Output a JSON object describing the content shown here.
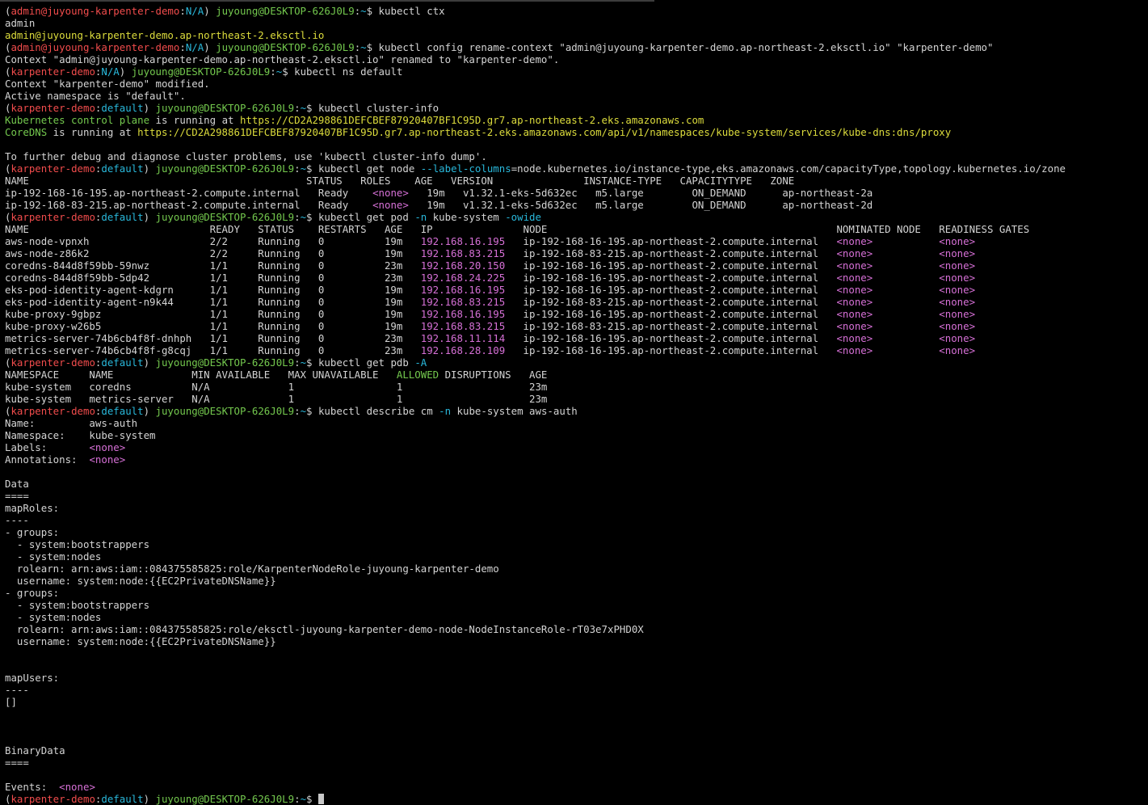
{
  "colors": {
    "background": "#000000",
    "default": "#d4d4d4",
    "red": "#f14c4c",
    "green": "#74c94e",
    "yellow": "#dcdc3c",
    "cyan": "#29b8db",
    "magenta": "#d670d6"
  },
  "lines": [
    [
      [
        "default",
        "("
      ],
      [
        "red",
        "admin@juyoung-karpenter-demo"
      ],
      [
        "default",
        ":"
      ],
      [
        "cyan",
        "N/A"
      ],
      [
        "default",
        ") "
      ],
      [
        "green",
        "juyoung@DESKTOP-626J0L9"
      ],
      [
        "default",
        ":"
      ],
      [
        "cyan",
        "~"
      ],
      [
        "default",
        "$ kubectl ctx"
      ]
    ],
    [
      [
        "default",
        "admin"
      ]
    ],
    [
      [
        "yellow",
        "admin@juyoung-karpenter-demo.ap-northeast-2.eksctl.io"
      ]
    ],
    [
      [
        "default",
        "("
      ],
      [
        "red",
        "admin@juyoung-karpenter-demo"
      ],
      [
        "default",
        ":"
      ],
      [
        "cyan",
        "N/A"
      ],
      [
        "default",
        ") "
      ],
      [
        "green",
        "juyoung@DESKTOP-626J0L9"
      ],
      [
        "default",
        ":"
      ],
      [
        "cyan",
        "~"
      ],
      [
        "default",
        "$ kubectl config rename-context \"admin@juyoung-karpenter-demo.ap-northeast-2.eksctl.io\" \"karpenter-demo\""
      ]
    ],
    [
      [
        "default",
        "Context \"admin@juyoung-karpenter-demo.ap-northeast-2.eksctl.io\" renamed to \"karpenter-demo\"."
      ]
    ],
    [
      [
        "default",
        "("
      ],
      [
        "red",
        "karpenter-demo"
      ],
      [
        "default",
        ":"
      ],
      [
        "cyan",
        "N/A"
      ],
      [
        "default",
        ") "
      ],
      [
        "green",
        "juyoung@DESKTOP-626J0L9"
      ],
      [
        "default",
        ":"
      ],
      [
        "cyan",
        "~"
      ],
      [
        "default",
        "$ kubectl ns default"
      ]
    ],
    [
      [
        "default",
        "Context \"karpenter-demo\" modified."
      ]
    ],
    [
      [
        "default",
        "Active namespace is \"default\"."
      ]
    ],
    [
      [
        "default",
        "("
      ],
      [
        "red",
        "karpenter-demo"
      ],
      [
        "default",
        ":"
      ],
      [
        "cyan",
        "default"
      ],
      [
        "default",
        ") "
      ],
      [
        "green",
        "juyoung@DESKTOP-626J0L9"
      ],
      [
        "default",
        ":"
      ],
      [
        "cyan",
        "~"
      ],
      [
        "default",
        "$ kubectl cluster-info"
      ]
    ],
    [
      [
        "green",
        "Kubernetes control plane"
      ],
      [
        "default",
        " is running at "
      ],
      [
        "yellow",
        "https://CD2A298861DEFCBEF87920407BF1C95D.gr7.ap-northeast-2.eks.amazonaws.com"
      ]
    ],
    [
      [
        "green",
        "CoreDNS"
      ],
      [
        "default",
        " is running at "
      ],
      [
        "yellow",
        "https://CD2A298861DEFCBEF87920407BF1C95D.gr7.ap-northeast-2.eks.amazonaws.com/api/v1/namespaces/kube-system/services/kube-dns:dns/proxy"
      ]
    ],
    [
      [
        "default",
        ""
      ]
    ],
    [
      [
        "default",
        "To further debug and diagnose cluster problems, use 'kubectl cluster-info dump'."
      ]
    ],
    [
      [
        "default",
        "("
      ],
      [
        "red",
        "karpenter-demo"
      ],
      [
        "default",
        ":"
      ],
      [
        "cyan",
        "default"
      ],
      [
        "default",
        ") "
      ],
      [
        "green",
        "juyoung@DESKTOP-626J0L9"
      ],
      [
        "default",
        ":"
      ],
      [
        "cyan",
        "~"
      ],
      [
        "default",
        "$ kubectl get node "
      ],
      [
        "cyan",
        "--label-columns"
      ],
      [
        "default",
        "=node.kubernetes.io/instance-type,eks.amazonaws.com/capacityType,topology.kubernetes.io/zone"
      ]
    ],
    [
      [
        "default",
        "NAME                                              STATUS   ROLES    AGE   VERSION               INSTANCE-TYPE   CAPACITYTYPE   ZONE"
      ]
    ],
    [
      [
        "default",
        "ip-192-168-16-195.ap-northeast-2.compute.internal   Ready    "
      ],
      [
        "magenta",
        "<none>"
      ],
      [
        "default",
        "   19m   v1.32.1-eks-5d632ec   m5.large        ON_DEMAND      ap-northeast-2a"
      ]
    ],
    [
      [
        "default",
        "ip-192-168-83-215.ap-northeast-2.compute.internal   Ready    "
      ],
      [
        "magenta",
        "<none>"
      ],
      [
        "default",
        "   19m   v1.32.1-eks-5d632ec   m5.large        ON_DEMAND      ap-northeast-2d"
      ]
    ],
    [
      [
        "default",
        "("
      ],
      [
        "red",
        "karpenter-demo"
      ],
      [
        "default",
        ":"
      ],
      [
        "cyan",
        "default"
      ],
      [
        "default",
        ") "
      ],
      [
        "green",
        "juyoung@DESKTOP-626J0L9"
      ],
      [
        "default",
        ":"
      ],
      [
        "cyan",
        "~"
      ],
      [
        "default",
        "$ kubectl get pod "
      ],
      [
        "cyan",
        "-n"
      ],
      [
        "default",
        " kube-system "
      ],
      [
        "cyan",
        "-owide"
      ]
    ],
    [
      [
        "default",
        "NAME                              READY   STATUS    RESTARTS   AGE   IP               NODE                                                NOMINATED NODE   READINESS GATES"
      ]
    ],
    [
      [
        "default",
        "aws-node-vpnxh                    2/2     Running   0          19m   "
      ],
      [
        "magenta",
        "192.168.16.195"
      ],
      [
        "default",
        "   ip-192-168-16-195.ap-northeast-2.compute.internal   "
      ],
      [
        "magenta",
        "<none>"
      ],
      [
        "default",
        "           "
      ],
      [
        "magenta",
        "<none>"
      ]
    ],
    [
      [
        "default",
        "aws-node-z86k2                    2/2     Running   0          19m   "
      ],
      [
        "magenta",
        "192.168.83.215"
      ],
      [
        "default",
        "   ip-192-168-83-215.ap-northeast-2.compute.internal   "
      ],
      [
        "magenta",
        "<none>"
      ],
      [
        "default",
        "           "
      ],
      [
        "magenta",
        "<none>"
      ]
    ],
    [
      [
        "default",
        "coredns-844d8f59bb-59nwz          1/1     Running   0          23m   "
      ],
      [
        "magenta",
        "192.168.20.150"
      ],
      [
        "default",
        "   ip-192-168-16-195.ap-northeast-2.compute.internal   "
      ],
      [
        "magenta",
        "<none>"
      ],
      [
        "default",
        "           "
      ],
      [
        "magenta",
        "<none>"
      ]
    ],
    [
      [
        "default",
        "coredns-844d8f59bb-5dp42          1/1     Running   0          23m   "
      ],
      [
        "magenta",
        "192.168.24.225"
      ],
      [
        "default",
        "   ip-192-168-16-195.ap-northeast-2.compute.internal   "
      ],
      [
        "magenta",
        "<none>"
      ],
      [
        "default",
        "           "
      ],
      [
        "magenta",
        "<none>"
      ]
    ],
    [
      [
        "default",
        "eks-pod-identity-agent-kdgrn      1/1     Running   0          19m   "
      ],
      [
        "magenta",
        "192.168.16.195"
      ],
      [
        "default",
        "   ip-192-168-16-195.ap-northeast-2.compute.internal   "
      ],
      [
        "magenta",
        "<none>"
      ],
      [
        "default",
        "           "
      ],
      [
        "magenta",
        "<none>"
      ]
    ],
    [
      [
        "default",
        "eks-pod-identity-agent-n9k44      1/1     Running   0          19m   "
      ],
      [
        "magenta",
        "192.168.83.215"
      ],
      [
        "default",
        "   ip-192-168-83-215.ap-northeast-2.compute.internal   "
      ],
      [
        "magenta",
        "<none>"
      ],
      [
        "default",
        "           "
      ],
      [
        "magenta",
        "<none>"
      ]
    ],
    [
      [
        "default",
        "kube-proxy-9gbpz                  1/1     Running   0          19m   "
      ],
      [
        "magenta",
        "192.168.16.195"
      ],
      [
        "default",
        "   ip-192-168-16-195.ap-northeast-2.compute.internal   "
      ],
      [
        "magenta",
        "<none>"
      ],
      [
        "default",
        "           "
      ],
      [
        "magenta",
        "<none>"
      ]
    ],
    [
      [
        "default",
        "kube-proxy-w26b5                  1/1     Running   0          19m   "
      ],
      [
        "magenta",
        "192.168.83.215"
      ],
      [
        "default",
        "   ip-192-168-83-215.ap-northeast-2.compute.internal   "
      ],
      [
        "magenta",
        "<none>"
      ],
      [
        "default",
        "           "
      ],
      [
        "magenta",
        "<none>"
      ]
    ],
    [
      [
        "default",
        "metrics-server-74b6cb4f8f-dnhph   1/1     Running   0          23m   "
      ],
      [
        "magenta",
        "192.168.11.114"
      ],
      [
        "default",
        "   ip-192-168-16-195.ap-northeast-2.compute.internal   "
      ],
      [
        "magenta",
        "<none>"
      ],
      [
        "default",
        "           "
      ],
      [
        "magenta",
        "<none>"
      ]
    ],
    [
      [
        "default",
        "metrics-server-74b6cb4f8f-g8cqj   1/1     Running   0          23m   "
      ],
      [
        "magenta",
        "192.168.28.109"
      ],
      [
        "default",
        "   ip-192-168-16-195.ap-northeast-2.compute.internal   "
      ],
      [
        "magenta",
        "<none>"
      ],
      [
        "default",
        "           "
      ],
      [
        "magenta",
        "<none>"
      ]
    ],
    [
      [
        "default",
        "("
      ],
      [
        "red",
        "karpenter-demo"
      ],
      [
        "default",
        ":"
      ],
      [
        "cyan",
        "default"
      ],
      [
        "default",
        ") "
      ],
      [
        "green",
        "juyoung@DESKTOP-626J0L9"
      ],
      [
        "default",
        ":"
      ],
      [
        "cyan",
        "~"
      ],
      [
        "default",
        "$ kubectl get pdb "
      ],
      [
        "cyan",
        "-A"
      ]
    ],
    [
      [
        "default",
        "NAMESPACE     NAME             MIN AVAILABLE   MAX UNAVAILABLE   "
      ],
      [
        "green",
        "ALLOWED"
      ],
      [
        "default",
        " DISRUPTIONS   AGE"
      ]
    ],
    [
      [
        "default",
        "kube-system   coredns          N/A             1                 1                     23m"
      ]
    ],
    [
      [
        "default",
        "kube-system   metrics-server   N/A             1                 1                     23m"
      ]
    ],
    [
      [
        "default",
        "("
      ],
      [
        "red",
        "karpenter-demo"
      ],
      [
        "default",
        ":"
      ],
      [
        "cyan",
        "default"
      ],
      [
        "default",
        ") "
      ],
      [
        "green",
        "juyoung@DESKTOP-626J0L9"
      ],
      [
        "default",
        ":"
      ],
      [
        "cyan",
        "~"
      ],
      [
        "default",
        "$ kubectl describe cm "
      ],
      [
        "cyan",
        "-n"
      ],
      [
        "default",
        " kube-system aws-auth"
      ]
    ],
    [
      [
        "default",
        "Name:         aws-auth"
      ]
    ],
    [
      [
        "default",
        "Namespace:    kube-system"
      ]
    ],
    [
      [
        "default",
        "Labels:       "
      ],
      [
        "magenta",
        "<none>"
      ]
    ],
    [
      [
        "default",
        "Annotations:  "
      ],
      [
        "magenta",
        "<none>"
      ]
    ],
    [
      [
        "default",
        ""
      ]
    ],
    [
      [
        "default",
        "Data"
      ]
    ],
    [
      [
        "default",
        "===="
      ]
    ],
    [
      [
        "default",
        "mapRoles:"
      ]
    ],
    [
      [
        "default",
        "----"
      ]
    ],
    [
      [
        "default",
        "- groups:"
      ]
    ],
    [
      [
        "default",
        "  - system:bootstrappers"
      ]
    ],
    [
      [
        "default",
        "  - system:nodes"
      ]
    ],
    [
      [
        "default",
        "  rolearn: arn:aws:iam::084375585825:role/KarpenterNodeRole-juyoung-karpenter-demo"
      ]
    ],
    [
      [
        "default",
        "  username: system:node:{{EC2PrivateDNSName}}"
      ]
    ],
    [
      [
        "default",
        "- groups:"
      ]
    ],
    [
      [
        "default",
        "  - system:bootstrappers"
      ]
    ],
    [
      [
        "default",
        "  - system:nodes"
      ]
    ],
    [
      [
        "default",
        "  rolearn: arn:aws:iam::084375585825:role/eksctl-juyoung-karpenter-demo-node-NodeInstanceRole-rT03e7xPHD0X"
      ]
    ],
    [
      [
        "default",
        "  username: system:node:{{EC2PrivateDNSName}}"
      ]
    ],
    [
      [
        "default",
        ""
      ]
    ],
    [
      [
        "default",
        ""
      ]
    ],
    [
      [
        "default",
        "mapUsers:"
      ]
    ],
    [
      [
        "default",
        "----"
      ]
    ],
    [
      [
        "default",
        "[]"
      ]
    ],
    [
      [
        "default",
        ""
      ]
    ],
    [
      [
        "default",
        ""
      ]
    ],
    [
      [
        "default",
        ""
      ]
    ],
    [
      [
        "default",
        "BinaryData"
      ]
    ],
    [
      [
        "default",
        "===="
      ]
    ],
    [
      [
        "default",
        ""
      ]
    ],
    [
      [
        "default",
        "Events:  "
      ],
      [
        "magenta",
        "<none>"
      ]
    ],
    [
      [
        "default",
        "("
      ],
      [
        "red",
        "karpenter-demo"
      ],
      [
        "default",
        ":"
      ],
      [
        "cyan",
        "default"
      ],
      [
        "default",
        ") "
      ],
      [
        "green",
        "juyoung@DESKTOP-626J0L9"
      ],
      [
        "default",
        ":"
      ],
      [
        "cyan",
        "~"
      ],
      [
        "default",
        "$ "
      ],
      [
        "cursor",
        ""
      ]
    ]
  ]
}
